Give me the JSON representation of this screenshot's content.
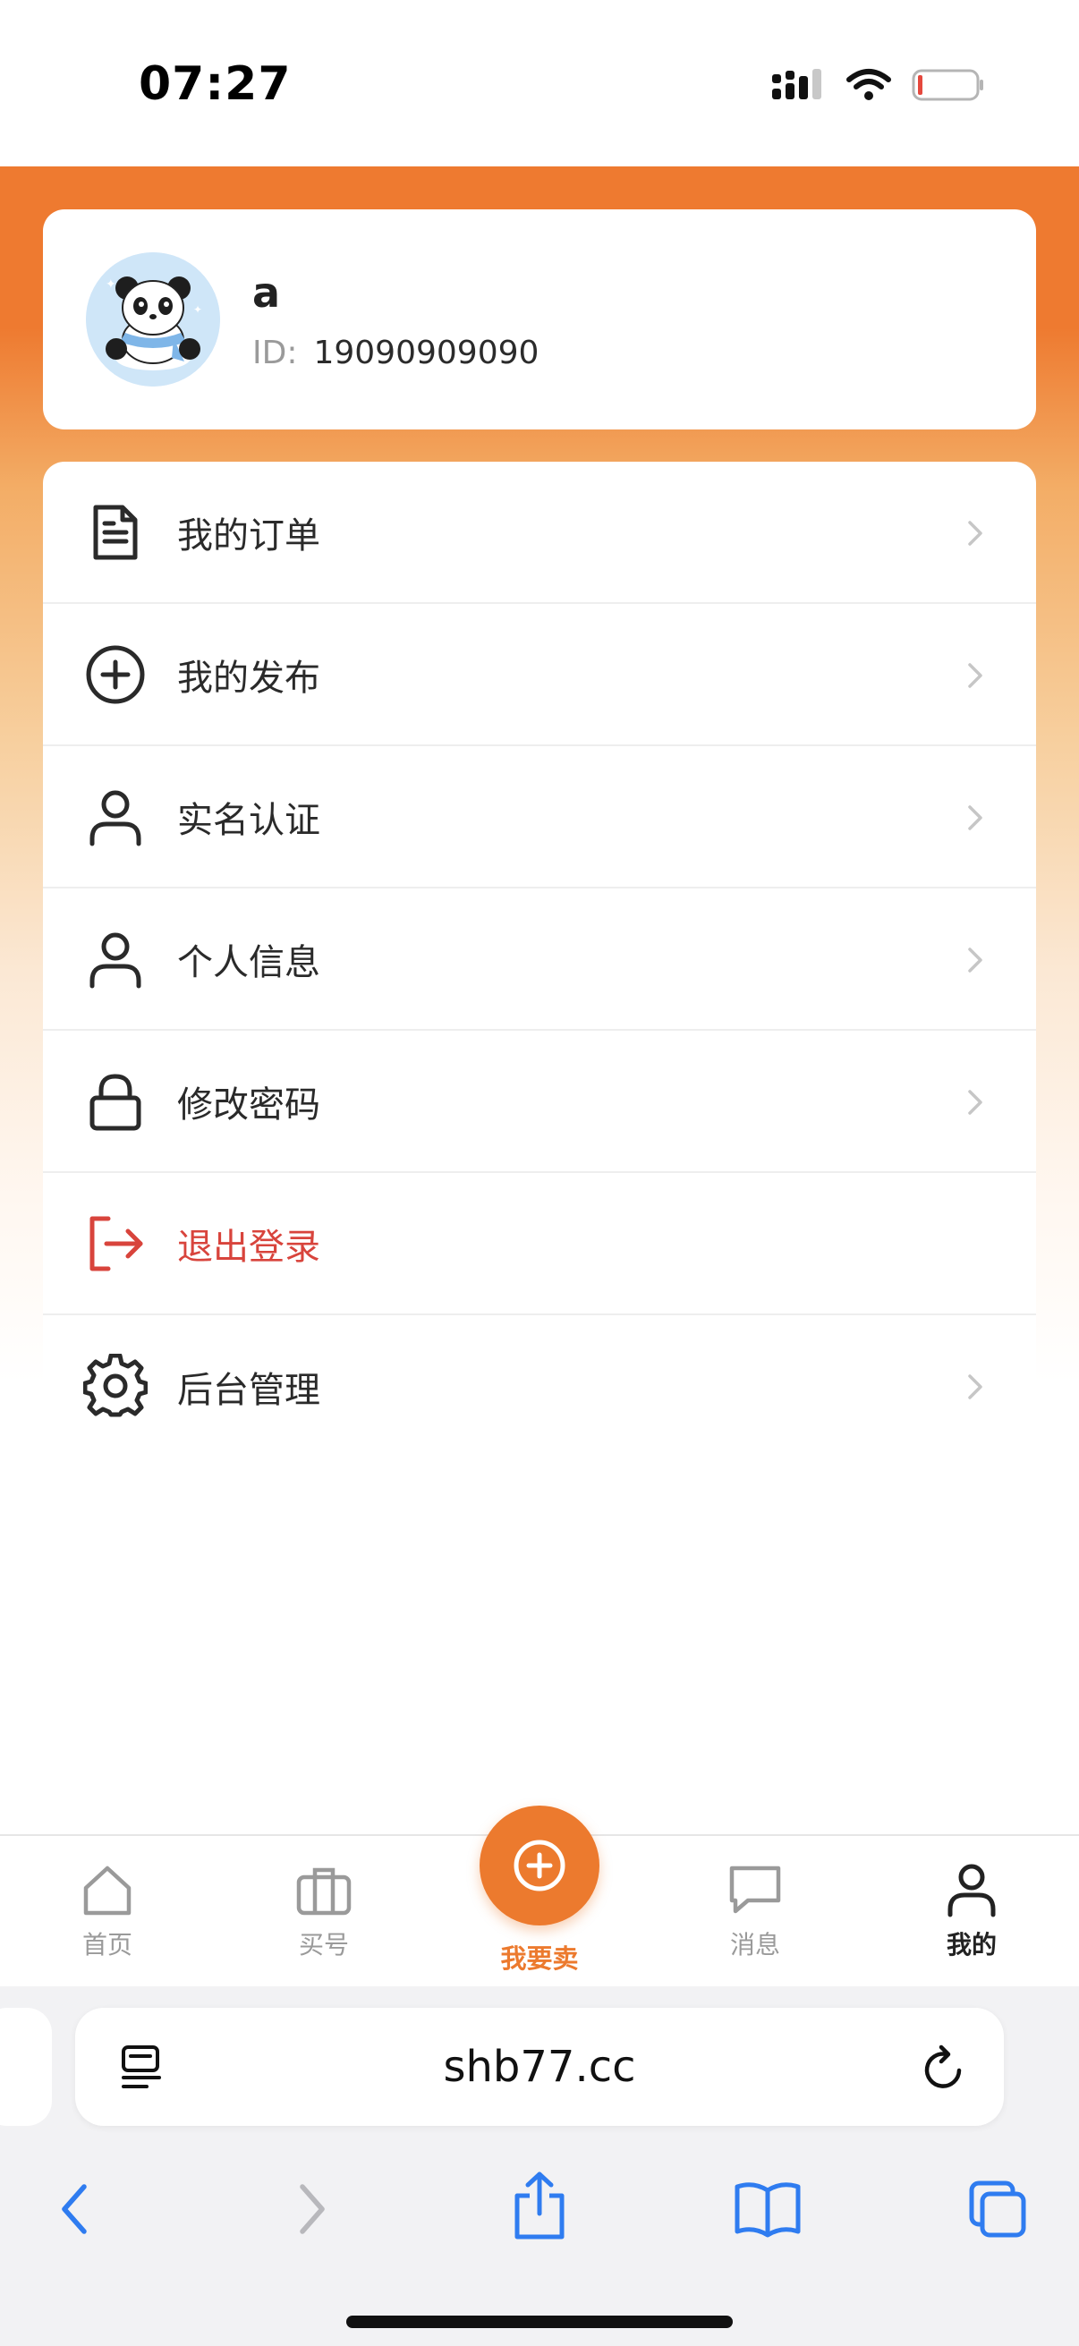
{
  "status": {
    "time": "07:27"
  },
  "profile": {
    "name": "a",
    "id_label": "ID:",
    "id_value": "19090909090"
  },
  "menu": {
    "items": [
      {
        "label": "我的订单",
        "icon": "document-icon"
      },
      {
        "label": "我的发布",
        "icon": "plus-circle-icon"
      },
      {
        "label": "实名认证",
        "icon": "person-icon"
      },
      {
        "label": "个人信息",
        "icon": "person-icon"
      },
      {
        "label": "修改密码",
        "icon": "lock-icon"
      },
      {
        "label": "退出登录",
        "icon": "logout-icon"
      },
      {
        "label": "后台管理",
        "icon": "gear-icon"
      }
    ]
  },
  "tabbar": {
    "home": "首页",
    "buy": "买号",
    "sell": "我要卖",
    "messages": "消息",
    "mine": "我的"
  },
  "browser": {
    "url": "shb77.cc"
  },
  "colors": {
    "accent": "#ec7a2e",
    "danger": "#d8443c",
    "battery_low": "#e5483d"
  }
}
